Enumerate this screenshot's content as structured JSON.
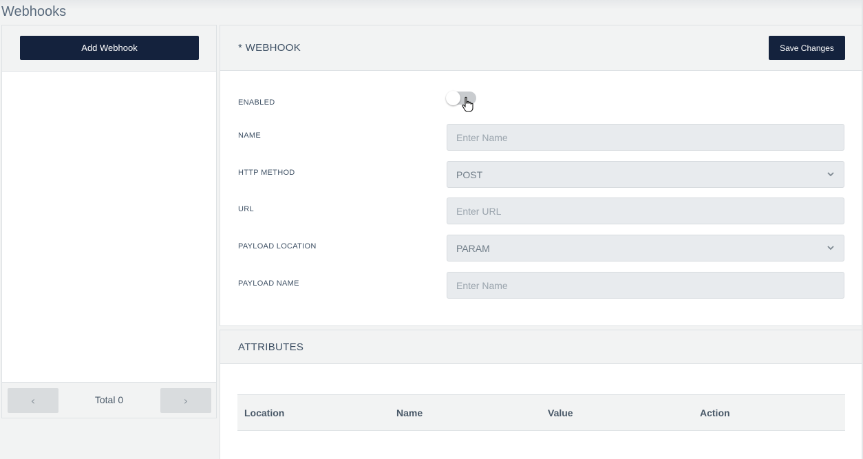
{
  "page": {
    "title": "Webhooks"
  },
  "left_panel": {
    "add_button_label": "Add Webhook",
    "pagination": {
      "prev": "‹",
      "next": "›",
      "total_label": "Total 0"
    }
  },
  "webhook": {
    "title": "* WEBHOOK",
    "save_label": "Save Changes",
    "fields": {
      "enabled": {
        "label": "ENABLED",
        "value": false
      },
      "name": {
        "label": "NAME",
        "placeholder": "Enter Name",
        "value": ""
      },
      "http_method": {
        "label": "HTTP METHOD",
        "value": "POST"
      },
      "url": {
        "label": "URL",
        "placeholder": "Enter URL",
        "value": ""
      },
      "payload_location": {
        "label": "PAYLOAD LOCATION",
        "value": "PARAM"
      },
      "payload_name": {
        "label": "PAYLOAD NAME",
        "placeholder": "Enter Name",
        "value": ""
      }
    }
  },
  "attributes": {
    "title": "ATTRIBUTES",
    "columns": [
      "Location",
      "Name",
      "Value",
      "Action"
    ],
    "rows": []
  },
  "icons": {
    "toggle": "toggle-icon",
    "cursor": "hand-pointer-icon",
    "select": "chevron-down-icon",
    "prev": "chevron-left-icon",
    "next": "chevron-right-icon"
  },
  "colors": {
    "primary_button": "#14223d",
    "background": "#f2f3f3",
    "field_bg": "#e8ebee",
    "text": "#3d4f63"
  }
}
